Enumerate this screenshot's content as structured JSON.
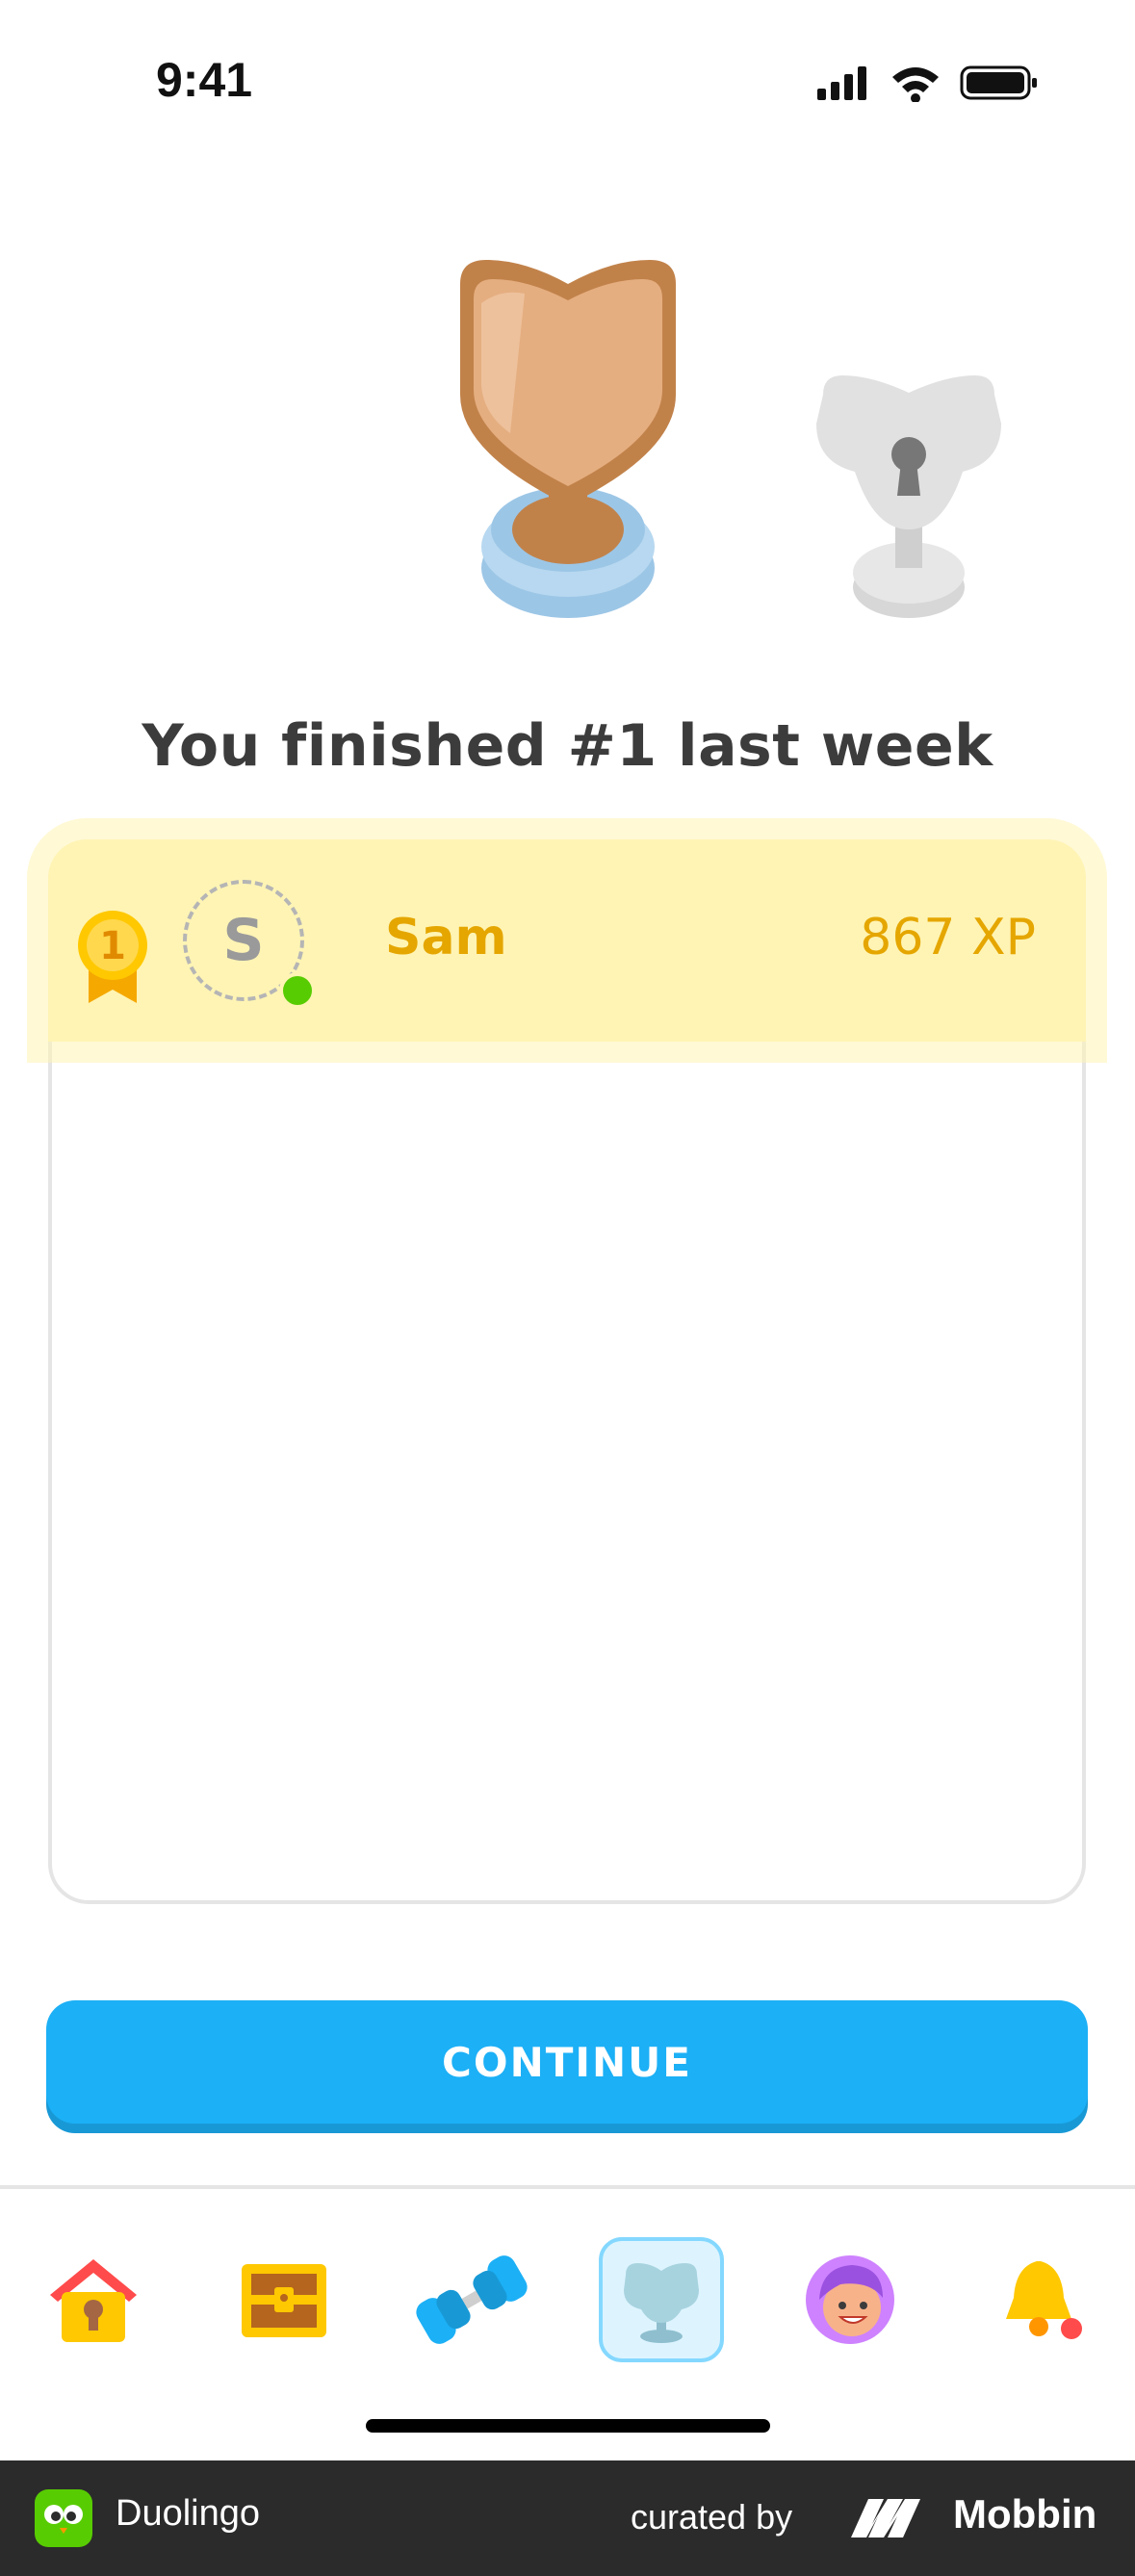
{
  "status": {
    "time": "9:41"
  },
  "headline": "You finished #1 last week",
  "leaderboard": {
    "rows": [
      {
        "rank": "1",
        "avatar_initial": "S",
        "name": "Sam",
        "xp": "867 XP",
        "online": true
      }
    ]
  },
  "continue_label": "CONTINUE",
  "tabbar": {
    "items": [
      {
        "name": "home",
        "icon": "home-icon"
      },
      {
        "name": "chest",
        "icon": "treasure-chest-icon"
      },
      {
        "name": "practice",
        "icon": "dumbbell-icon"
      },
      {
        "name": "leaderboards",
        "icon": "trophy-icon",
        "active": true
      },
      {
        "name": "profile",
        "icon": "avatar-icon"
      },
      {
        "name": "notifications",
        "icon": "bell-icon"
      }
    ]
  },
  "footer": {
    "app_name": "Duolingo",
    "curated_by": "curated by",
    "brand": "Mobbin"
  },
  "colors": {
    "accent": "#1cb0f6",
    "highlight": "#fff4b4",
    "gold_text": "#e5a600",
    "online": "#58cc02"
  }
}
